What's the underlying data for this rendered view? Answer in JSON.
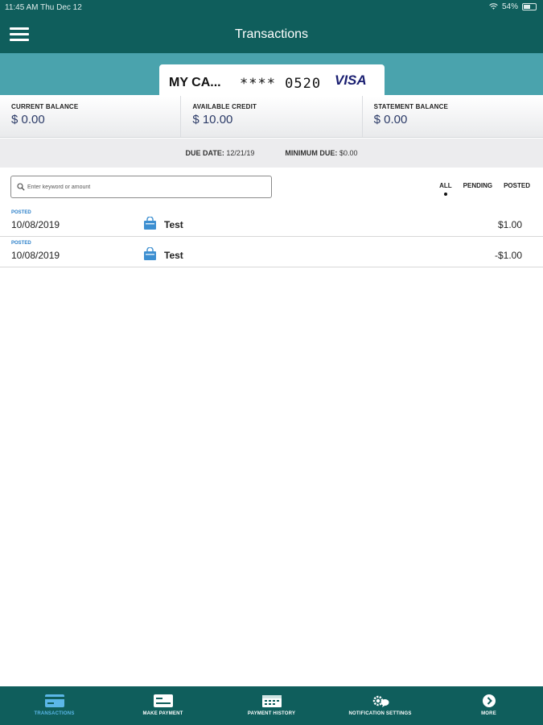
{
  "status_bar": {
    "time_date": "11:45 AM   Thu Dec 12",
    "battery": "54%",
    "battery_level": 0.54
  },
  "header": {
    "title": "Transactions"
  },
  "card": {
    "name": "MY CA...",
    "number": "**** 0520",
    "network": "VISA"
  },
  "balances": [
    {
      "label": "CURRENT BALANCE",
      "value": "$ 0.00"
    },
    {
      "label": "AVAILABLE CREDIT",
      "value": "$ 10.00"
    },
    {
      "label": "STATEMENT BALANCE",
      "value": "$ 0.00"
    }
  ],
  "due": {
    "date_label": "DUE DATE:",
    "date_value": "12/21/19",
    "min_label": "MINIMUM DUE:",
    "min_value": "$0.00"
  },
  "search": {
    "placeholder": "Enter keyword or amount"
  },
  "filters": {
    "all": "ALL",
    "pending": "PENDING",
    "posted": "POSTED",
    "selected": "ALL"
  },
  "transactions": [
    {
      "status": "POSTED",
      "date": "10/08/2019",
      "merchant": "Test",
      "amount": "$1.00"
    },
    {
      "status": "POSTED",
      "date": "10/08/2019",
      "merchant": "Test",
      "amount": "-$1.00"
    }
  ],
  "tabs": [
    {
      "label": "TRANSACTIONS",
      "icon": "card-icon",
      "active": true
    },
    {
      "label": "MAKE PAYMENT",
      "icon": "payment-icon",
      "active": false
    },
    {
      "label": "PAYMENT HISTORY",
      "icon": "calendar-icon",
      "active": false
    },
    {
      "label": "NOTIFICATION SETTINGS",
      "icon": "gear-chat-icon",
      "active": false
    },
    {
      "label": "MORE",
      "icon": "chevron-right-circle-icon",
      "active": false
    }
  ],
  "colors": {
    "primary": "#0f5e5c",
    "band": "#4aa3ad",
    "active_tab": "#5bb7e8",
    "visa": "#1a1f71",
    "balance": "#2b3a67"
  }
}
